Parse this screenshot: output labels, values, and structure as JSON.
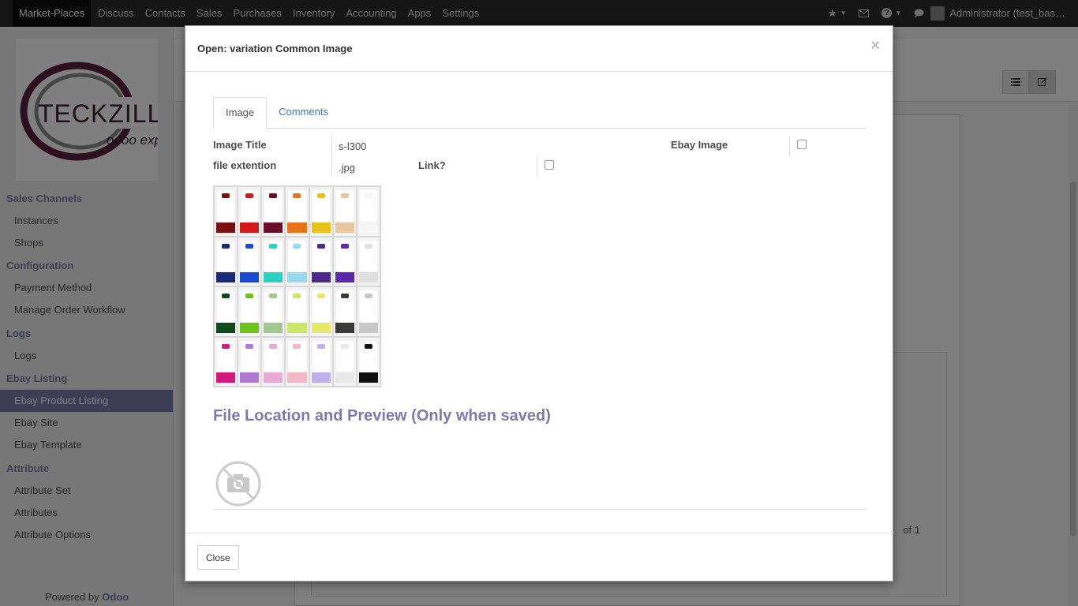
{
  "navbar": {
    "items": [
      "Market-Places",
      "Discuss",
      "Contacts",
      "Sales",
      "Purchases",
      "Inventory",
      "Accounting",
      "Apps",
      "Settings"
    ],
    "user": "Administrator (test_bas…"
  },
  "sidebar": {
    "logo": {
      "brand": "TECKZILLA",
      "tagline": "odoo expert"
    },
    "groups": [
      {
        "head": "Sales Channels",
        "items": [
          "Instances",
          "Shops"
        ]
      },
      {
        "head": "Configuration",
        "items": [
          "Payment Method",
          "Manage Order Workflow"
        ]
      },
      {
        "head": "Logs",
        "items": [
          "Logs"
        ]
      },
      {
        "head": "Ebay Listing",
        "items": [
          "Ebay Product Listing",
          "Ebay Site",
          "Ebay Template"
        ]
      },
      {
        "head": "Attribute",
        "items": [
          "Attribute Set",
          "Attributes",
          "Attribute Options"
        ]
      }
    ],
    "active_item": "Ebay Product Listing",
    "powered_prefix": "Powered by",
    "powered_brand": "Odoo"
  },
  "background": {
    "pager": "of 1"
  },
  "modal": {
    "title": "Open: variation Common Image",
    "close_glyph": "×",
    "tabs": [
      "Image",
      "Comments"
    ],
    "fields": {
      "image_title_label": "Image Title",
      "image_title_value": "s-l300",
      "ebay_image_label": "Ebay Image",
      "ebay_image_checked": false,
      "file_ext_label": "file extention",
      "file_ext_value": ".jpg",
      "link_label": "Link?",
      "link_checked": false
    },
    "section_title": "File Location and Preview (Only when saved)",
    "footer_close": "Close"
  },
  "colors": {
    "accent": "#7c7bad",
    "link": "#337ab7",
    "navbar_bg": "#2d2d2d"
  },
  "icons": [
    "bug-icon",
    "envelope-icon",
    "help-icon",
    "chat-icon",
    "list-view-icon",
    "form-view-icon",
    "no-photo-icon"
  ]
}
